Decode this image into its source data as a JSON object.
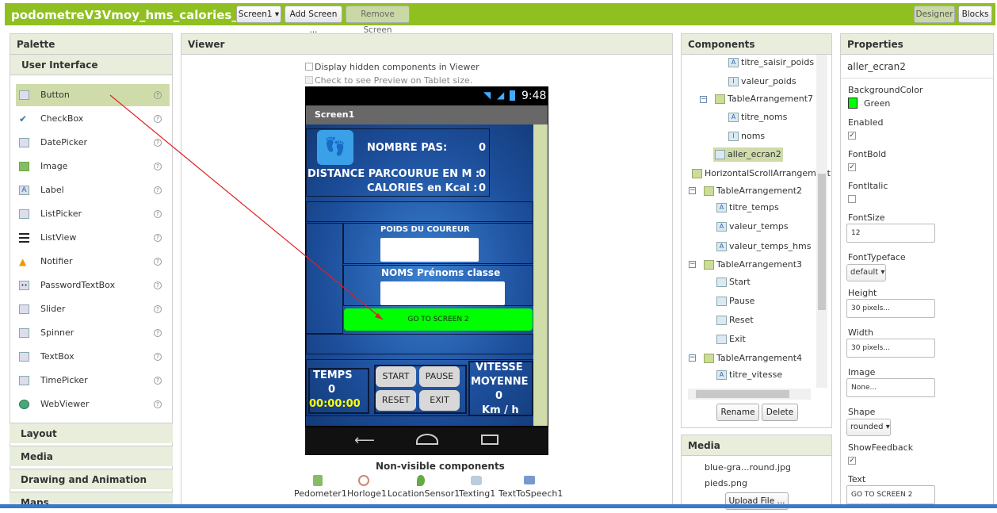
{
  "app": {
    "project_title": "podometreV3Vmoy_hms_calories_GPS",
    "screen_select": "Screen1 ▾",
    "add_screen": "Add Screen ...",
    "remove_screen": "Remove Screen",
    "designer": "Designer",
    "blocks": "Blocks"
  },
  "palette": {
    "title": "Palette",
    "section": "User Interface",
    "items": [
      {
        "label": "Button",
        "icon": "button-icon"
      },
      {
        "label": "CheckBox",
        "icon": "checkbox-icon"
      },
      {
        "label": "DatePicker",
        "icon": "calendar-icon"
      },
      {
        "label": "Image",
        "icon": "image-icon"
      },
      {
        "label": "Label",
        "icon": "label-icon"
      },
      {
        "label": "ListPicker",
        "icon": "listpicker-icon"
      },
      {
        "label": "ListView",
        "icon": "listview-icon"
      },
      {
        "label": "Notifier",
        "icon": "warning-icon"
      },
      {
        "label": "PasswordTextBox",
        "icon": "password-icon"
      },
      {
        "label": "Slider",
        "icon": "slider-icon"
      },
      {
        "label": "Spinner",
        "icon": "spinner-icon"
      },
      {
        "label": "TextBox",
        "icon": "textbox-icon"
      },
      {
        "label": "TimePicker",
        "icon": "clock-icon"
      },
      {
        "label": "WebViewer",
        "icon": "globe-icon"
      }
    ],
    "other_sections": [
      "Layout",
      "Media",
      "Drawing and Animation",
      "Maps"
    ]
  },
  "viewer": {
    "title": "Viewer",
    "hidden_chk": "Display hidden components in Viewer",
    "tablet_chk": "Check to see Preview on Tablet size.",
    "time": "9:48",
    "screen_name": "Screen1",
    "nb_pas_label": "NOMBRE PAS:",
    "nb_pas_val": "0",
    "distance_label": "DISTANCE  PARCOURUE EN M :",
    "distance_val": "0",
    "calories_label": "CALORIES en Kcal :",
    "calories_val": "0",
    "poids_label": "POIDS DU COUREUR",
    "noms_label": "NOMS Prénoms classe",
    "goto_btn": "GO TO SCREEN 2",
    "temps_label": "TEMPS",
    "temps_val": "0",
    "temps_hms": "00:00:00",
    "start": "START",
    "pause": "PAUSE",
    "reset": "RESET",
    "exit": "EXIT",
    "vitesse_label": "VITESSE",
    "moyenne_label": "MOYENNE",
    "vitesse_val": "0",
    "vitesse_unit": "Km / h",
    "nonvisible_title": "Non-visible components",
    "nonvisible": [
      "Pedometer1",
      "Horloge1",
      "LocationSensor1",
      "Texting1",
      "TextToSpeech1"
    ]
  },
  "components": {
    "title": "Components",
    "items": [
      "titre_saisir_poids",
      "valeur_poids",
      "TableArrangement7",
      "titre_noms",
      "noms",
      "aller_ecran2",
      "HorizontalScrollArrangement",
      "TableArrangement2",
      "titre_temps",
      "valeur_temps",
      "valeur_temps_hms",
      "TableArrangement3",
      "Start",
      "Pause",
      "Reset",
      "Exit",
      "TableArrangement4",
      "titre_vitesse"
    ],
    "rename": "Rename",
    "delete": "Delete"
  },
  "media": {
    "title": "Media",
    "files": [
      "blue-gra...round.jpg",
      "pieds.png"
    ],
    "upload": "Upload File ..."
  },
  "properties": {
    "title": "Properties",
    "component": "aller_ecran2",
    "bg_label": "BackgroundColor",
    "bg_val": "Green",
    "bg_color": "#00ff00",
    "enabled": "Enabled",
    "fontbold": "FontBold",
    "fontitalic": "FontItalic",
    "fontsize_label": "FontSize",
    "fontsize_val": "12",
    "typeface_label": "FontTypeface",
    "typeface_val": "default ▾",
    "height_label": "Height",
    "height_val": "30 pixels...",
    "width_label": "Width",
    "width_val": "30 pixels...",
    "image_label": "Image",
    "image_val": "None...",
    "shape_label": "Shape",
    "shape_val": "rounded ▾",
    "showfeedback": "ShowFeedback",
    "text_label": "Text",
    "text_val": "GO TO SCREEN 2"
  }
}
